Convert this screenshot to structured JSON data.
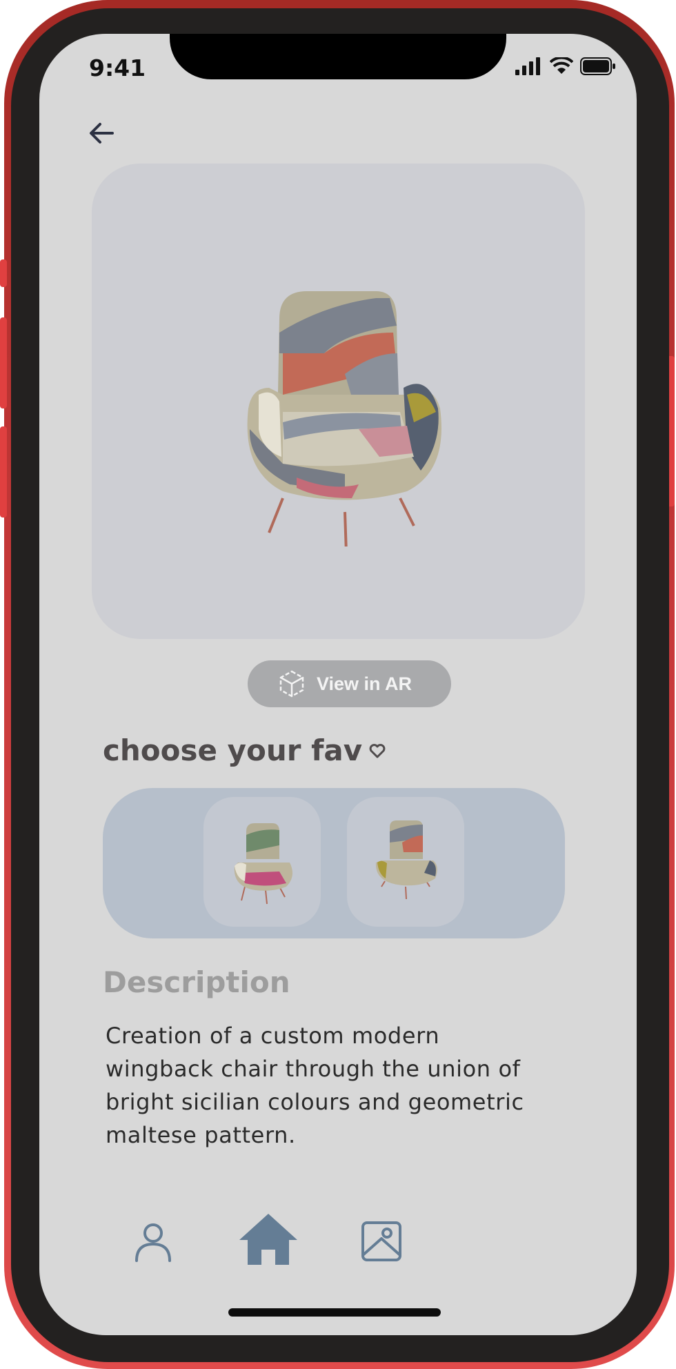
{
  "status": {
    "time": "9:41"
  },
  "ar_button": {
    "label": "View in AR"
  },
  "favorites": {
    "title": "choose your fav"
  },
  "description": {
    "title": "Description",
    "lines": [
      "Creation of a custom modern",
      "wingback chair through the union of",
      "bright sicilian colours and geometric",
      "maltese pattern."
    ]
  },
  "nav": {
    "items": [
      "profile-icon",
      "home-icon",
      "gallery-icon"
    ],
    "active": "home-icon"
  },
  "colors": {
    "screen_bg": "#d8d8d8",
    "card_bg": "#cdced3",
    "fav_strip": "#b6bfcb",
    "nav_accent": "#647d95",
    "ar_button": "#a9aaac"
  }
}
